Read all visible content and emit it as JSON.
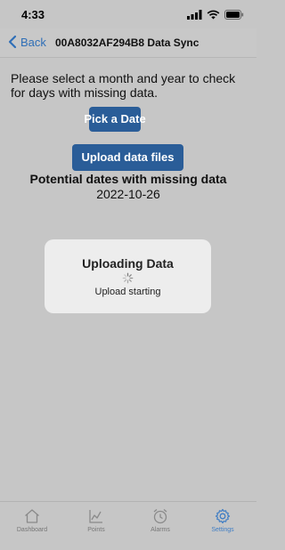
{
  "status_bar": {
    "time": "4:33"
  },
  "nav": {
    "back_label": "Back",
    "title": "00A8032AF294B8 Data Sync"
  },
  "content": {
    "instruction": "Please select a month and year to check for days with missing data.",
    "pick_date_button": "Pick a Date",
    "upload_button": "Upload data files",
    "missing_heading": "Potential dates with missing data",
    "missing_date": "2022-10-26"
  },
  "modal": {
    "title": "Uploading Data",
    "status": "Upload starting"
  },
  "tabs": [
    {
      "label": "Dashboard",
      "icon": "home-icon",
      "active": false
    },
    {
      "label": "Points",
      "icon": "chart-icon",
      "active": false
    },
    {
      "label": "Alarms",
      "icon": "alarm-clock-icon",
      "active": false
    },
    {
      "label": "Settings",
      "icon": "gear-icon",
      "active": true
    }
  ],
  "colors": {
    "accent": "#2f6fb7",
    "button": "#2a5d98",
    "background": "#c6c6c6",
    "modal": "#ededed"
  }
}
